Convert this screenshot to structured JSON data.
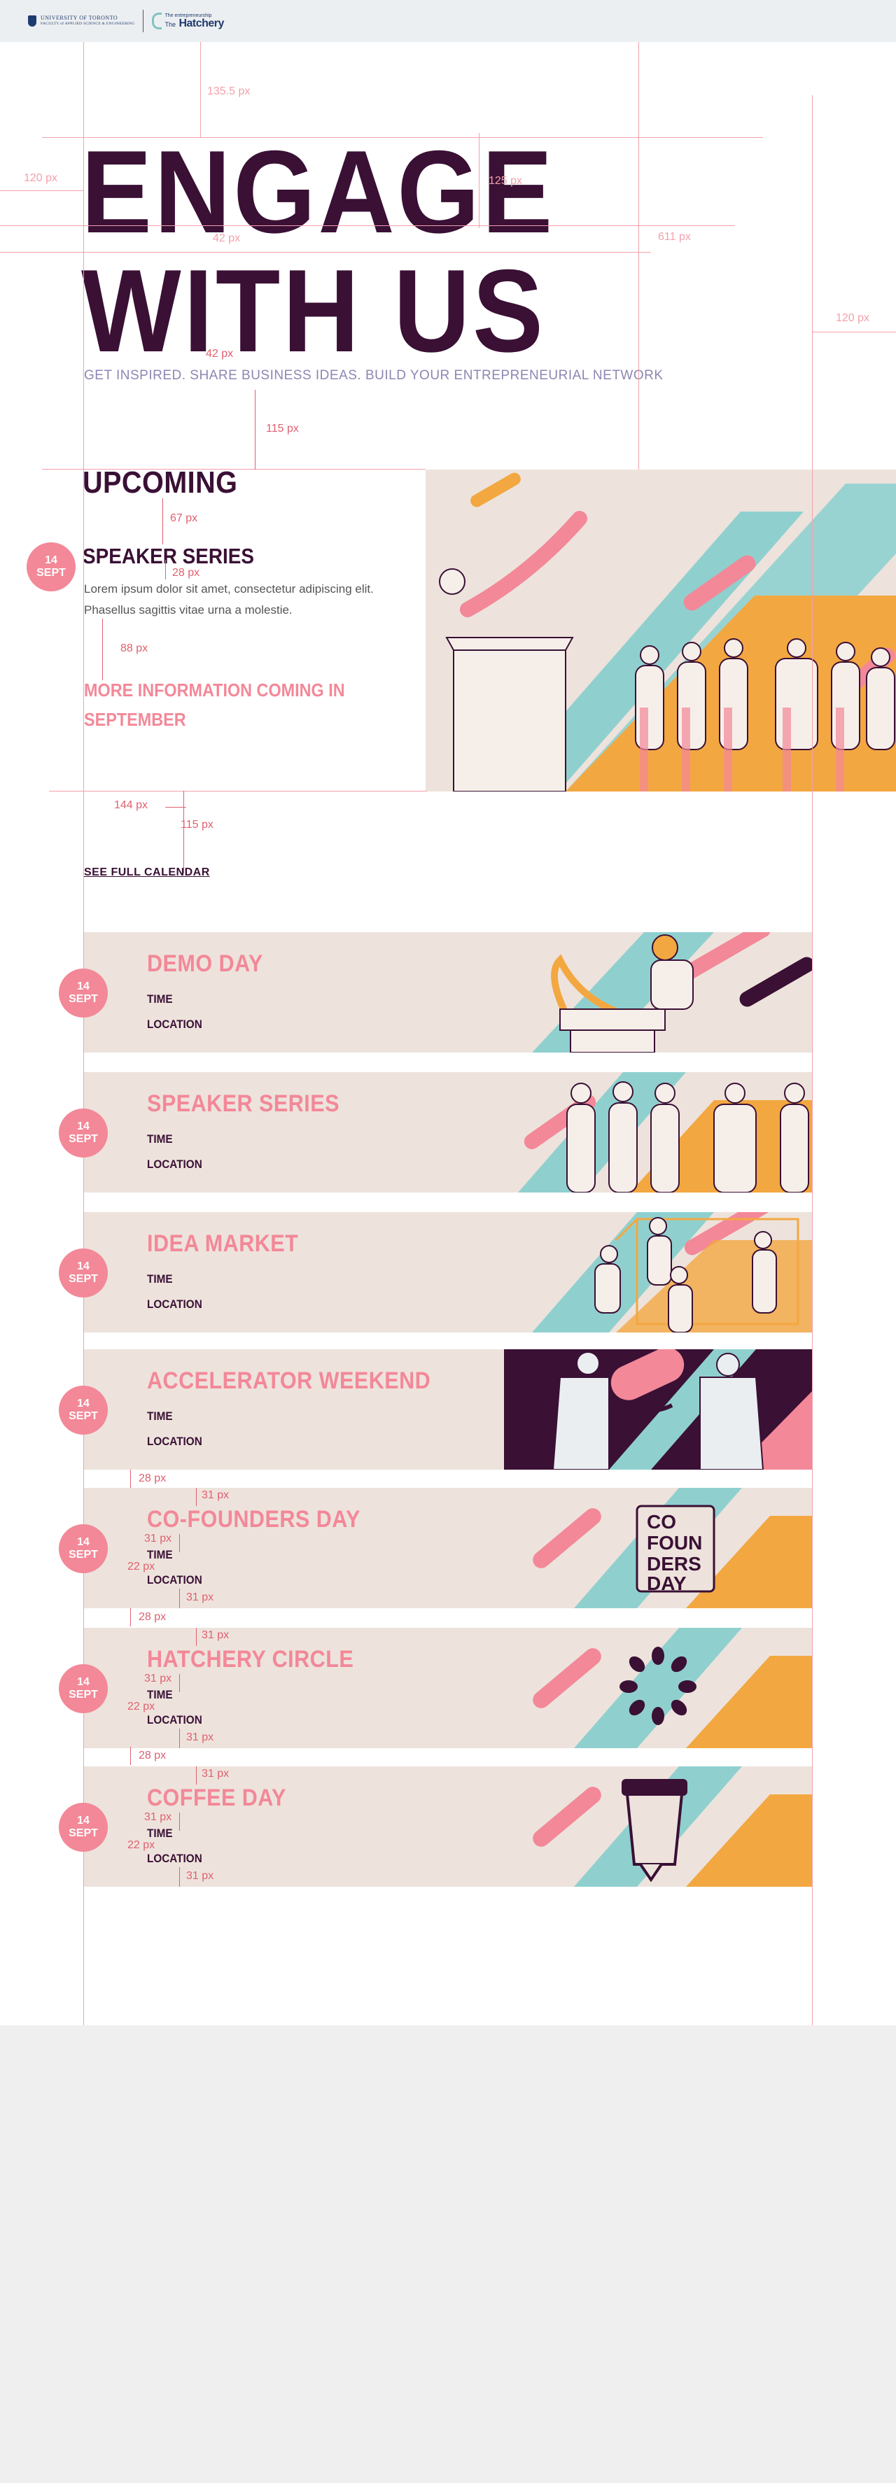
{
  "header": {
    "uoft_line1": "UNIVERSITY OF TORONTO",
    "uoft_line2": "FACULTY of APPLIED SCIENCE & ENGINEERING",
    "hatchery_small": "The entrepreneurship",
    "hatchery_the": "The",
    "hatchery_name": "Hatchery"
  },
  "hero": {
    "title_line1": "ENGAGE",
    "title_line2": "WITH US",
    "tagline": "GET INSPIRED. SHARE BUSINESS IDEAS. BUILD YOUR ENTREPRENEURIAL NETWORK"
  },
  "upcoming": {
    "heading": "UPCOMING",
    "date_day": "14",
    "date_month": "SEPT",
    "title": "SPEAKER SERIES",
    "description": "Lorem ipsum dolor sit amet, consectetur adipiscing elit. Phasellus sagittis vitae urna a molestie.",
    "more_info": "MORE INFORMATION COMING IN SEPTEMBER"
  },
  "calendar_link": "SEE FULL CALENDAR",
  "events": [
    {
      "day": "14",
      "month": "SEPT",
      "title": "DEMO DAY",
      "time_label": "TIME",
      "location_label": "LOCATION"
    },
    {
      "day": "14",
      "month": "SEPT",
      "title": "SPEAKER SERIES",
      "time_label": "TIME",
      "location_label": "LOCATION"
    },
    {
      "day": "14",
      "month": "SEPT",
      "title": "IDEA MARKET",
      "time_label": "TIME",
      "location_label": "LOCATION"
    },
    {
      "day": "14",
      "month": "SEPT",
      "title": "ACCELERATOR WEEKEND",
      "time_label": "TIME",
      "location_label": "LOCATION"
    },
    {
      "day": "14",
      "month": "SEPT",
      "title": "CO-FOUNDERS DAY",
      "time_label": "TIME",
      "location_label": "LOCATION",
      "badge_lines": [
        "CO",
        "FOUN",
        "DERS",
        "DAY"
      ]
    },
    {
      "day": "14",
      "month": "SEPT",
      "title": "HATCHERY CIRCLE",
      "time_label": "TIME",
      "location_label": "LOCATION"
    },
    {
      "day": "14",
      "month": "SEPT",
      "title": "COFFEE DAY",
      "time_label": "TIME",
      "location_label": "LOCATION"
    }
  ],
  "spec": {
    "m135": "135.5 px",
    "m120a": "120 px",
    "m125": "125 px",
    "m42a": "42 px",
    "m611": "611 px",
    "m120b": "120 px",
    "m42b": "42 px",
    "m115a": "115 px",
    "m67": "67 px",
    "m28a": "28 px",
    "m88": "88 px",
    "m144": "144 px",
    "m115b": "115 px",
    "m28": "28 px",
    "m31": "31 px",
    "m22": "22 px"
  },
  "colors": {
    "plum": "#3a1035",
    "pink": "#f38898",
    "teal": "#8fd0cf",
    "orange": "#f3a741",
    "beige": "#ede3dc",
    "guide": "#f2a1ab"
  }
}
